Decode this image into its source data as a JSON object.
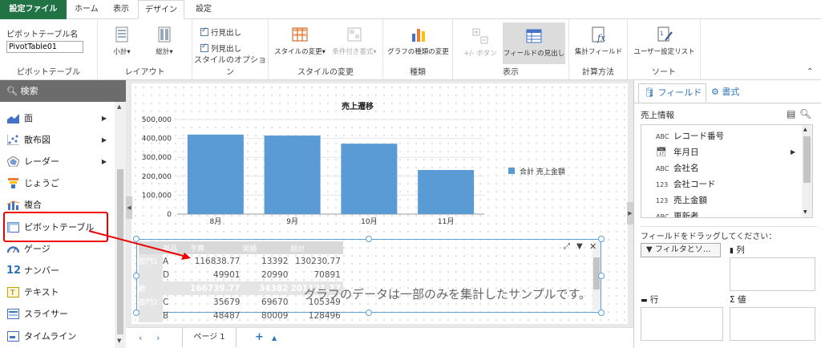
{
  "tabs": {
    "file": "設定ファイル",
    "home": "ホーム",
    "view": "表示",
    "design": "デザイン",
    "settings": "設定"
  },
  "ribbon": {
    "pivot_name_label": "ピボットテーブル名",
    "pivot_name_value": "PivotTable01",
    "group_pivot": "ピボットテーブル",
    "subtotal": "小計",
    "grandtotal": "総計",
    "group_layout": "レイアウト",
    "row_header": "行見出し",
    "col_header": "列見出し",
    "group_style_options": "スタイルのオプション",
    "style_change": "スタイルの変更",
    "conditional_format": "条件付き書式",
    "group_style_change": "スタイルの変更",
    "chart_type_change": "グラフの種類の変更",
    "group_type": "種類",
    "plusminus_button": "+/- ボタン",
    "field_header": "フィールドの見出し",
    "group_display": "表示",
    "calc_field": "集計フィールド",
    "group_calc": "計算方法",
    "custom_list": "ユーザー設定リスト",
    "group_sort": "ソート"
  },
  "left_panel": {
    "search": "検索",
    "items": [
      {
        "label": "面",
        "arrow": true
      },
      {
        "label": "散布図",
        "arrow": true
      },
      {
        "label": "レーダー",
        "arrow": true
      },
      {
        "label": "じょうご",
        "arrow": false
      },
      {
        "label": "複合",
        "arrow": false
      },
      {
        "label": "ピボットテーブル",
        "arrow": false
      },
      {
        "label": "ゲージ",
        "arrow": false
      },
      {
        "label": "ナンバー",
        "icon_text": "12",
        "arrow": false
      },
      {
        "label": "テキスト",
        "arrow": false
      },
      {
        "label": "スライサー",
        "arrow": false
      },
      {
        "label": "タイムライン",
        "arrow": false
      }
    ]
  },
  "chart_data": {
    "type": "bar",
    "title": "売上遷移",
    "categories": [
      "8月",
      "9月",
      "10月",
      "11月"
    ],
    "series": [
      {
        "name": "合計 売上金額",
        "values": [
          420000,
          415000,
          372000,
          233000
        ]
      }
    ],
    "ylim": [
      0,
      500000
    ],
    "yticks": [
      "500,000",
      "400,000",
      "300,000",
      "200,000",
      "100,000",
      "0"
    ],
    "legend": "right",
    "color": "#5b9bd5"
  },
  "pivot_table": {
    "headers": [
      "部品",
      "予算",
      "実績",
      "総計"
    ],
    "rows": [
      {
        "g": "部門1",
        "k": "A",
        "v": [
          "116838.77",
          "13392",
          "130230.77"
        ]
      },
      {
        "g": "",
        "k": "D",
        "v": [
          "49901",
          "20990",
          "70891"
        ]
      },
      {
        "g": "計",
        "k": "",
        "v": [
          "166739.77",
          "34382",
          "201121.77"
        ]
      },
      {
        "g": "部門2",
        "k": "C",
        "v": [
          "35679",
          "69670",
          "105349"
        ]
      },
      {
        "g": "",
        "k": "B",
        "v": [
          "48487",
          "80009",
          "128496"
        ]
      }
    ],
    "watermark": "グラフのデータは一部のみを集計したサンプルです。"
  },
  "bottom": {
    "page_tab": "ページ 1"
  },
  "right_panel": {
    "tab_fields": "フィールド",
    "tab_format": "書式",
    "source": "売上情報",
    "fields": [
      {
        "type": "ABC",
        "name": "レコード番号"
      },
      {
        "type": "cal",
        "name": "年月日"
      },
      {
        "type": "ABC",
        "name": "会社名"
      },
      {
        "type": "123",
        "name": "会社コード"
      },
      {
        "type": "123",
        "name": "売上金額"
      },
      {
        "type": "ABC",
        "name": "更新者"
      }
    ],
    "drag_hint": "フィールドをドラッグしてください：",
    "filter_chip": "フィルタとソ…",
    "columns": "列",
    "rows": "行",
    "values": "値"
  }
}
